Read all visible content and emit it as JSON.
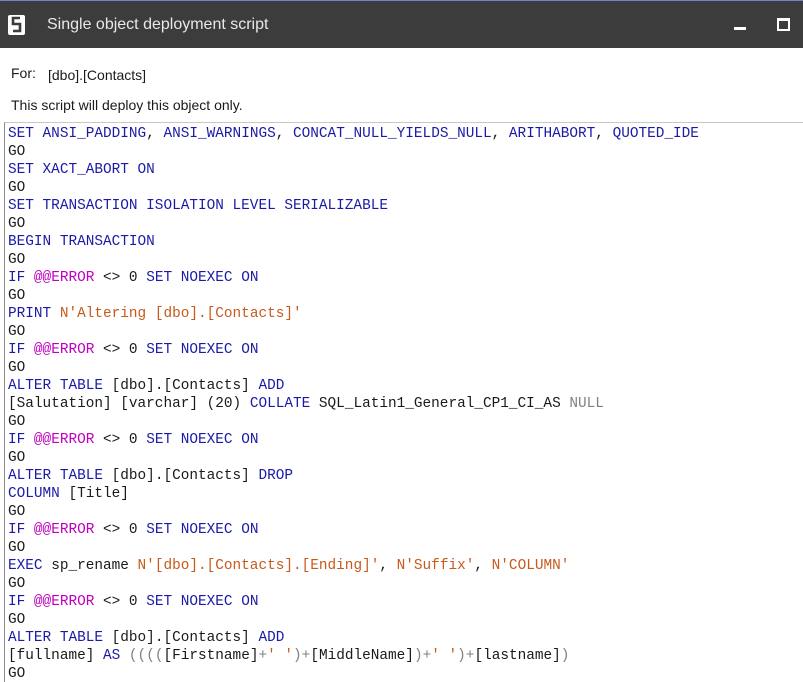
{
  "window": {
    "title": "Single object deployment script",
    "minimize_icon": "minimize-icon",
    "maximize_icon": "maximize-icon"
  },
  "header": {
    "for_label": "For:",
    "object_name": "[dbo].[Contacts]",
    "info": "This script will deploy this object only."
  },
  "script": {
    "lines": [
      [
        [
          "kw",
          "SET "
        ],
        [
          "kw",
          "ANSI_PADDING"
        ],
        [
          "pl",
          ", "
        ],
        [
          "kw",
          "ANSI_WARNINGS"
        ],
        [
          "pl",
          ", "
        ],
        [
          "kw",
          "CONCAT_NULL_YIELDS_NULL"
        ],
        [
          "pl",
          ", "
        ],
        [
          "kw",
          "ARITHABORT"
        ],
        [
          "pl",
          ", "
        ],
        [
          "kw",
          "QUOTED_IDE"
        ]
      ],
      [
        [
          "pl",
          "GO"
        ]
      ],
      [
        [
          "kw",
          "SET XACT_ABORT ON"
        ]
      ],
      [
        [
          "pl",
          "GO"
        ]
      ],
      [
        [
          "kw",
          "SET TRANSACTION ISOLATION LEVEL SERIALIZABLE"
        ]
      ],
      [
        [
          "pl",
          "GO"
        ]
      ],
      [
        [
          "kw",
          "BEGIN TRANSACTION"
        ]
      ],
      [
        [
          "pl",
          "GO"
        ]
      ],
      [
        [
          "kw",
          "IF "
        ],
        [
          "sy",
          "@@ERROR"
        ],
        [
          "pl",
          " <> 0 "
        ],
        [
          "kw",
          "SET NOEXEC ON"
        ]
      ],
      [
        [
          "pl",
          "GO"
        ]
      ],
      [
        [
          "kw",
          "PRINT "
        ],
        [
          "st",
          "N'Altering [dbo].[Contacts]'"
        ]
      ],
      [
        [
          "pl",
          "GO"
        ]
      ],
      [
        [
          "kw",
          "IF "
        ],
        [
          "sy",
          "@@ERROR"
        ],
        [
          "pl",
          " <> 0 "
        ],
        [
          "kw",
          "SET NOEXEC ON"
        ]
      ],
      [
        [
          "pl",
          "GO"
        ]
      ],
      [
        [
          "kw",
          "ALTER TABLE "
        ],
        [
          "pl",
          "[dbo].[Contacts] "
        ],
        [
          "kw",
          "ADD"
        ]
      ],
      [
        [
          "pl",
          "[Salutation] [varchar] (20) "
        ],
        [
          "kw",
          "COLLATE "
        ],
        [
          "pl",
          "SQL_Latin1_General_CP1_CI_AS "
        ],
        [
          "gray",
          "NULL"
        ]
      ],
      [
        [
          "pl",
          "GO"
        ]
      ],
      [
        [
          "kw",
          "IF "
        ],
        [
          "sy",
          "@@ERROR"
        ],
        [
          "pl",
          " <> 0 "
        ],
        [
          "kw",
          "SET NOEXEC ON"
        ]
      ],
      [
        [
          "pl",
          "GO"
        ]
      ],
      [
        [
          "kw",
          "ALTER TABLE "
        ],
        [
          "pl",
          "[dbo].[Contacts] "
        ],
        [
          "kw",
          "DROP"
        ]
      ],
      [
        [
          "kw",
          "COLUMN "
        ],
        [
          "pl",
          "[Title]"
        ]
      ],
      [
        [
          "pl",
          "GO"
        ]
      ],
      [
        [
          "kw",
          "IF "
        ],
        [
          "sy",
          "@@ERROR"
        ],
        [
          "pl",
          " <> 0 "
        ],
        [
          "kw",
          "SET NOEXEC ON"
        ]
      ],
      [
        [
          "pl",
          "GO"
        ]
      ],
      [
        [
          "kw",
          "EXEC "
        ],
        [
          "pl",
          "sp_rename "
        ],
        [
          "st",
          "N'[dbo].[Contacts].[Ending]'"
        ],
        [
          "pl",
          ", "
        ],
        [
          "st",
          "N'Suffix'"
        ],
        [
          "pl",
          ", "
        ],
        [
          "st",
          "N'COLUMN'"
        ]
      ],
      [
        [
          "pl",
          "GO"
        ]
      ],
      [
        [
          "kw",
          "IF "
        ],
        [
          "sy",
          "@@ERROR"
        ],
        [
          "pl",
          " <> 0 "
        ],
        [
          "kw",
          "SET NOEXEC ON"
        ]
      ],
      [
        [
          "pl",
          "GO"
        ]
      ],
      [
        [
          "kw",
          "ALTER TABLE "
        ],
        [
          "pl",
          "[dbo].[Contacts] "
        ],
        [
          "kw",
          "ADD"
        ]
      ],
      [
        [
          "pl",
          "[fullname] "
        ],
        [
          "kw",
          "AS "
        ],
        [
          "gray",
          "(((("
        ],
        [
          "pl",
          "[Firstname]"
        ],
        [
          "gray",
          "+"
        ],
        [
          "st",
          "' '"
        ],
        [
          "gray",
          ")+"
        ],
        [
          "pl",
          "[MiddleName]"
        ],
        [
          "gray",
          ")+"
        ],
        [
          "st",
          "' '"
        ],
        [
          "gray",
          ")+"
        ],
        [
          "pl",
          "[lastname]"
        ],
        [
          "gray",
          ")"
        ]
      ],
      [
        [
          "pl",
          "GO"
        ]
      ]
    ]
  },
  "colors": {
    "keyword": "#1a1aa6",
    "system_function": "#c000c0",
    "string": "#c85a1c",
    "operator": "#808080",
    "titlebar": "#3c3c3c"
  }
}
